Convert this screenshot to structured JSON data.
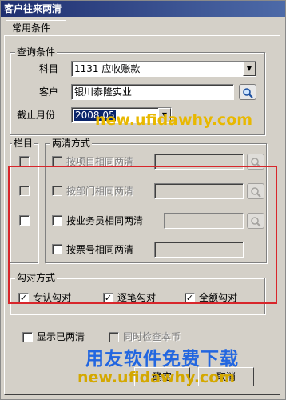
{
  "window": {
    "title": "客户往来两清"
  },
  "tabs": [
    {
      "label": "常用条件"
    }
  ],
  "query": {
    "legend": "查询条件",
    "subject_label": "科目",
    "subject_value": "1131 应收账款",
    "customer_label": "客户",
    "customer_value": "银川泰隆实业",
    "month_label": "截止月份",
    "month_value": "2008.05"
  },
  "column_group": {
    "legend": "栏目"
  },
  "clear_method": {
    "legend": "两清方式",
    "options": [
      {
        "label": "按项目相同两清",
        "checked": false,
        "enabled": false
      },
      {
        "label": "按部门相同两清",
        "checked": false,
        "enabled": false
      },
      {
        "label": "按业务员相同两清",
        "checked": false,
        "enabled": true
      },
      {
        "label": "按票号相同两清",
        "checked": false,
        "enabled": true
      }
    ]
  },
  "match_method": {
    "legend": "勾对方式",
    "options": [
      {
        "label": "专认勾对",
        "checked": true
      },
      {
        "label": "逐笔勾对",
        "checked": true
      },
      {
        "label": "全额勾对",
        "checked": true
      }
    ]
  },
  "show_cleared": {
    "label": "显示已两清",
    "checked": false
  },
  "check_current": {
    "label": "同时检查本币",
    "checked": false,
    "enabled": false
  },
  "buttons": {
    "ok": "确定",
    "cancel": "取消"
  },
  "watermarks": {
    "url_top": "new.ufidawhy.com",
    "slogan": "用友软件免费下载",
    "url_bottom": "new.ufidawhy.com"
  },
  "icons": {
    "lookup": "magnifier-icon",
    "dropdown": "triangle-down-icon",
    "check": "checkmark-icon"
  },
  "colors": {
    "highlight_border": "#d8262b",
    "title_bar": "#1f2f6f",
    "selection": "#0a246a"
  }
}
